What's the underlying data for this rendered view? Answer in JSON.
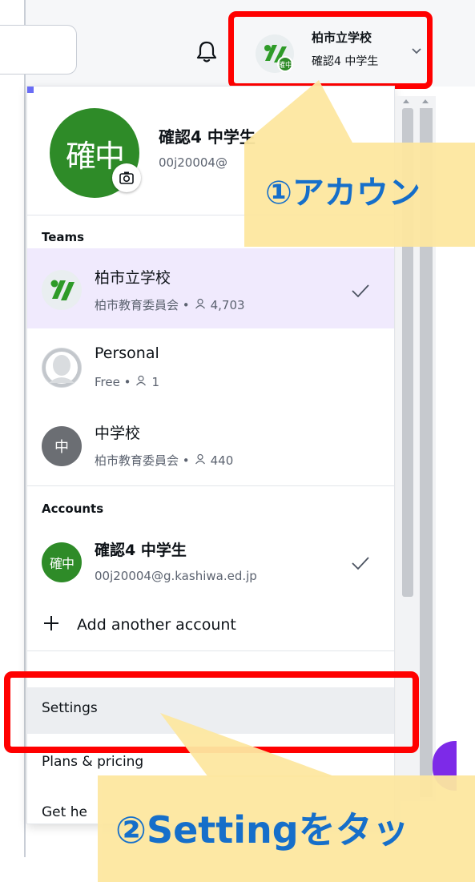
{
  "header": {
    "team_name": "柏市立学校",
    "user_name": "確認4 中学生",
    "avatar_glyph": "%",
    "avatar_badge": "確中"
  },
  "profile": {
    "avatar_text": "確中",
    "name": "確認4 中学生",
    "email": "00j20004@"
  },
  "teams": {
    "label": "Teams",
    "items": [
      {
        "title": "柏市立学校",
        "subtitle": "柏市教育委員会 •",
        "members": "4,703",
        "selected": true
      },
      {
        "title": "Personal",
        "subtitle": "Free •",
        "members": "1",
        "selected": false
      },
      {
        "title": "中学校",
        "subtitle": "柏市教育委員会 •",
        "members": "440",
        "avatar_text": "中",
        "selected": false
      }
    ]
  },
  "accounts": {
    "label": "Accounts",
    "items": [
      {
        "avatar_text": "確中",
        "title": "確認4 中学生",
        "subtitle": "00j20004@g.kashiwa.ed.jp",
        "selected": true
      }
    ],
    "add_label": "Add another account"
  },
  "menu": {
    "settings": "Settings",
    "plans": "Plans & pricing",
    "help": "Get he"
  },
  "annotations": {
    "step1": "①アカウン",
    "step2": "②Settingをタッ"
  },
  "colors": {
    "accent": "#7d2ae8",
    "selected_row": "#f0eafd",
    "highlight_box": "#ff0000",
    "callout_bg": "#fde7a0",
    "callout_text": "#0a68c8",
    "team_green": "#2e8b28"
  }
}
